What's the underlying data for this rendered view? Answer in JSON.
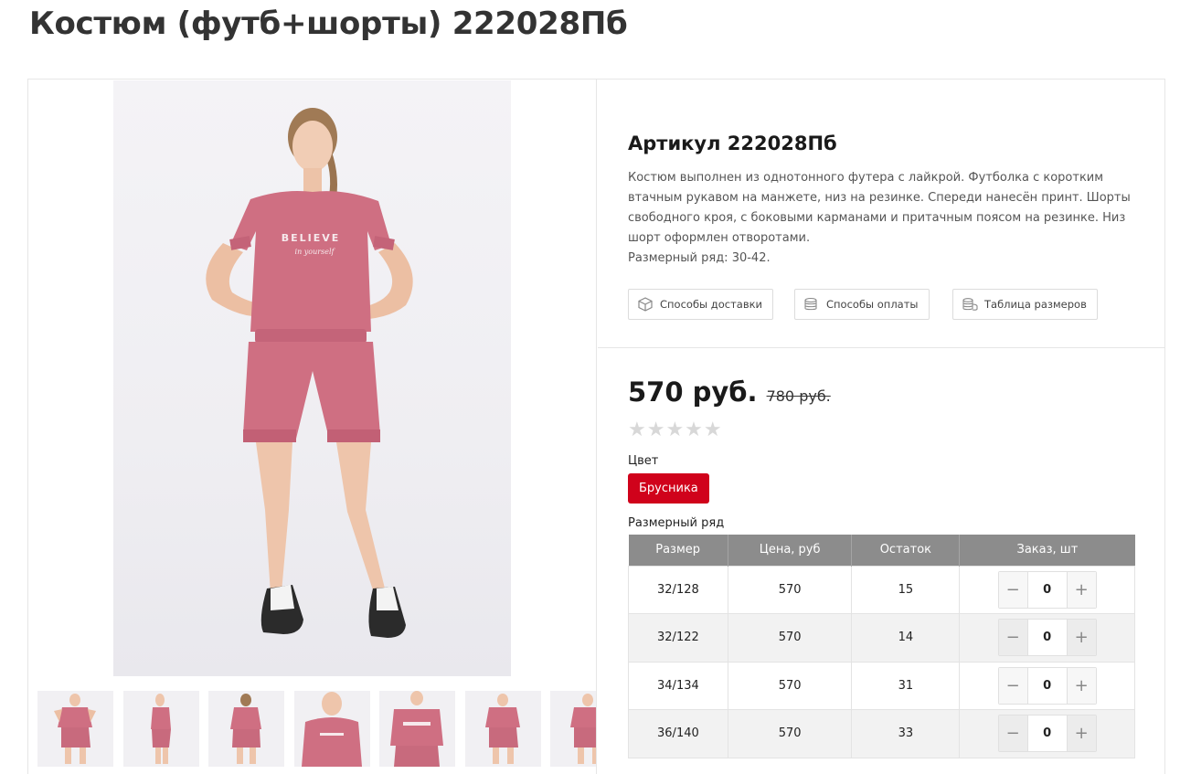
{
  "page": {
    "title": "Костюм (футб+шорты) 222028Пб"
  },
  "product": {
    "article": "Артикул 222028Пб",
    "description": "Костюм выполнен из однотонного футера с лайкрой. Футболка с коротким втачным рукавом на манжете, низ на резинке. Спереди нанесён принт. Шорты свободного кроя, с боковыми карманами и притачным поясом на резинке. Низ шорт оформлен отворотами.",
    "size_range_note": "Размерный ряд: 30-42.",
    "print_text_line1": "BELIEVE",
    "print_text_line2": "in yourself",
    "price": "570 руб.",
    "old_price": "780 руб.",
    "rating_stars": "★★★★★",
    "rating_value": 0,
    "color_label": "Цвет",
    "selected_color": "Брусника",
    "size_label": "Размерный ряд"
  },
  "info_buttons": [
    {
      "label": "Способы доставки",
      "icon": "box-icon"
    },
    {
      "label": "Способы оплаты",
      "icon": "coins-icon"
    },
    {
      "label": "Таблица размеров",
      "icon": "coins-stack-icon"
    }
  ],
  "size_table": {
    "headers": [
      "Размер",
      "Цена, руб",
      "Остаток",
      "Заказ, шт"
    ],
    "rows": [
      {
        "size": "32/128",
        "price": "570",
        "stock": "15",
        "qty": "0",
        "minus": "−",
        "plus": "+"
      },
      {
        "size": "32/122",
        "price": "570",
        "stock": "14",
        "qty": "0",
        "minus": "−",
        "plus": "+"
      },
      {
        "size": "34/134",
        "price": "570",
        "stock": "31",
        "qty": "0",
        "minus": "−",
        "plus": "+"
      },
      {
        "size": "36/140",
        "price": "570",
        "stock": "33",
        "qty": "0",
        "minus": "−",
        "plus": "+"
      }
    ]
  },
  "colors": {
    "accent": "#d0021b",
    "table_header": "#8c8c8c",
    "garment": "#cf6f82"
  }
}
